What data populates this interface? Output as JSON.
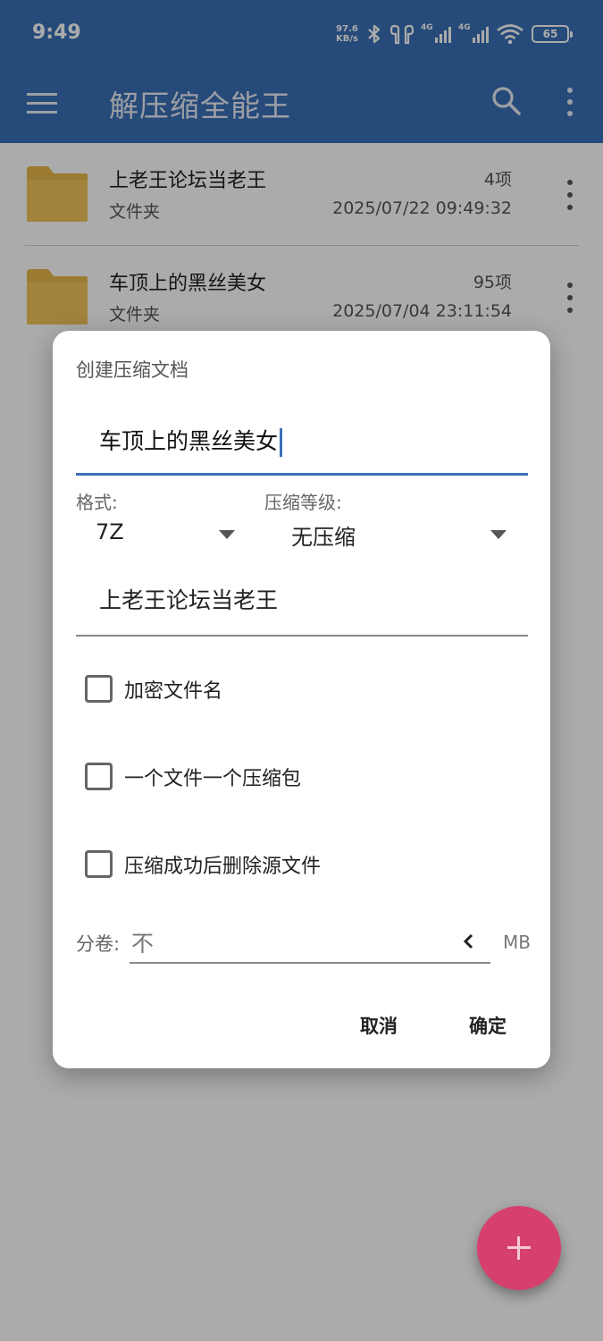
{
  "status_bar": {
    "time": "9:49",
    "net_speed_value": "97.6",
    "net_speed_unit": "KB/s",
    "sim1": "4G",
    "sim2": "4G",
    "battery": "65"
  },
  "app_bar": {
    "title": "解压缩全能王",
    "icons": [
      "menu-icon",
      "search-icon",
      "more-vert-icon"
    ]
  },
  "files": [
    {
      "name": "上老王论坛当老王",
      "type": "文件夹",
      "count": "4项",
      "date": "2025/07/22 09:49:32"
    },
    {
      "name": "车顶上的黑丝美女",
      "type": "文件夹",
      "count": "95项",
      "date": "2025/07/04 23:11:54"
    }
  ],
  "dialog": {
    "title": "创建压缩文档",
    "name_value": "车顶上的黑丝美女",
    "format_label": "格式:",
    "format_value": "7Z",
    "level_label": "压缩等级:",
    "level_value": "无压缩",
    "path_value": "上老王论坛当老王",
    "checkboxes": [
      {
        "label": "加密文件名",
        "checked": false
      },
      {
        "label": "一个文件一个压缩包",
        "checked": false
      },
      {
        "label": "压缩成功后删除源文件",
        "checked": false
      }
    ],
    "split_label": "分卷:",
    "split_value": "不",
    "split_unit": "MB",
    "cancel_label": "取消",
    "ok_label": "确定"
  },
  "colors": {
    "primary": "#3a6fb5",
    "accent": "#d6406d",
    "folder": "#e8b84a"
  }
}
